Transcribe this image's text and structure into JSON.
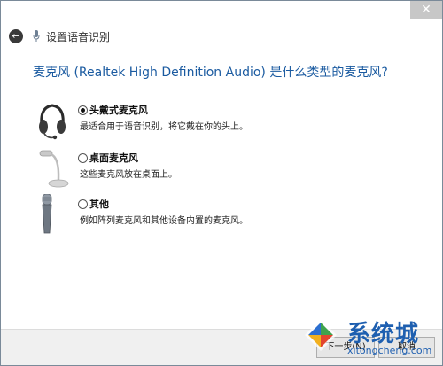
{
  "window": {
    "close_glyph": "✕"
  },
  "header": {
    "title": "设置语音识别",
    "back_icon": "back-arrow-icon"
  },
  "question": "麦克风 (Realtek High Definition Audio) 是什么类型的麦克风?",
  "options": [
    {
      "label": "头戴式麦克风",
      "description": "最适合用于语音识别，将它戴在你的头上。",
      "selected": true,
      "icon": "headset-icon"
    },
    {
      "label": "桌面麦克风",
      "description": "这些麦克风放在桌面上。",
      "selected": false,
      "icon": "desktop-microphone-icon"
    },
    {
      "label": "其他",
      "description": "例如阵列麦克风和其他设备内置的麦克风。",
      "selected": false,
      "icon": "handheld-microphone-icon"
    }
  ],
  "footer": {
    "next_label": "下一步(N)",
    "cancel_label": "取消"
  },
  "watermark": {
    "name": "系统城",
    "domain": "xitongcheng.com"
  },
  "colors": {
    "question_text": "#1a5aa0",
    "watermark": "#1e5fb0",
    "footer_bg": "#f0f0f0"
  }
}
